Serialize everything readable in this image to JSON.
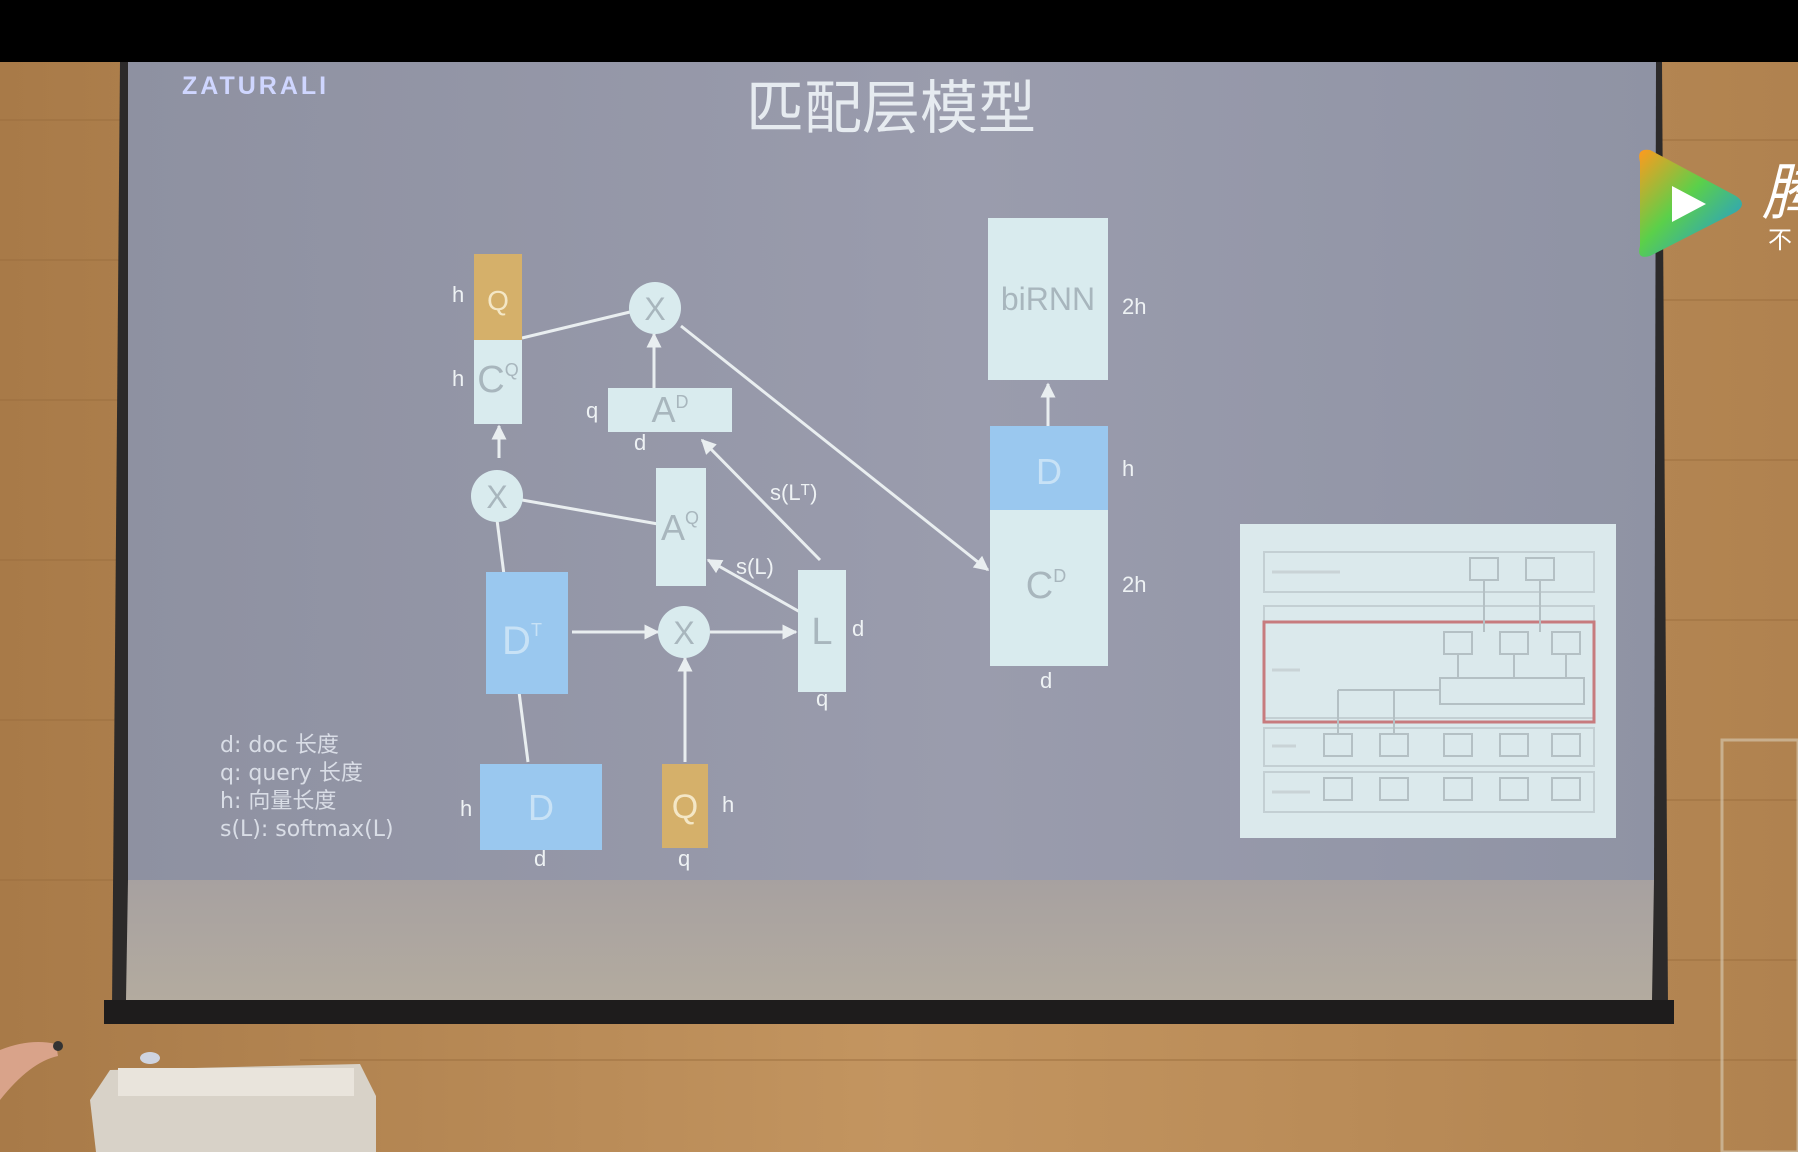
{
  "slide": {
    "logo": "ZATURALI",
    "title": "匹配层模型"
  },
  "diagram": {
    "blocks": {
      "q_top": "Q",
      "cq_base": "C",
      "cq_sup": "Q",
      "ad_base": "A",
      "ad_sup": "D",
      "aq_base": "A",
      "aq_sup": "Q",
      "dt_base": "D",
      "dt_sup": "T",
      "l": "L",
      "d_bottom": "D",
      "q_bottom": "Q",
      "birnn": "biRNN",
      "d_right": "D",
      "cd_base": "C",
      "cd_sup": "D"
    },
    "multiply_symbol": "X",
    "arrow_labels": {
      "s_lt": "s(Lᵀ)",
      "s_l": "s(L)"
    },
    "dims": {
      "q_top_h": "h",
      "cq_h": "h",
      "ad_q": "q",
      "ad_d": "d",
      "l_d": "d",
      "l_q": "q",
      "d_bottom_h": "h",
      "d_bottom_d": "d",
      "q_bottom_h": "h",
      "q_bottom_q": "q",
      "birnn_2h": "2h",
      "d_right_h": "h",
      "cd_2h": "2h",
      "cd_d": "d"
    }
  },
  "legend": [
    "d: doc 长度",
    "q: query 长度",
    "h: 向量长度",
    "s(L): softmax(L)"
  ],
  "watermark": {
    "brand_char": "腾",
    "sub_char": "不"
  },
  "colors": {
    "slide_bg": "#9698aa",
    "box_light": "#d9ebee",
    "box_blue": "#9ac8ef",
    "box_gold": "#d5b06a",
    "line": "#e9eef0",
    "wood": "#b98a55"
  }
}
